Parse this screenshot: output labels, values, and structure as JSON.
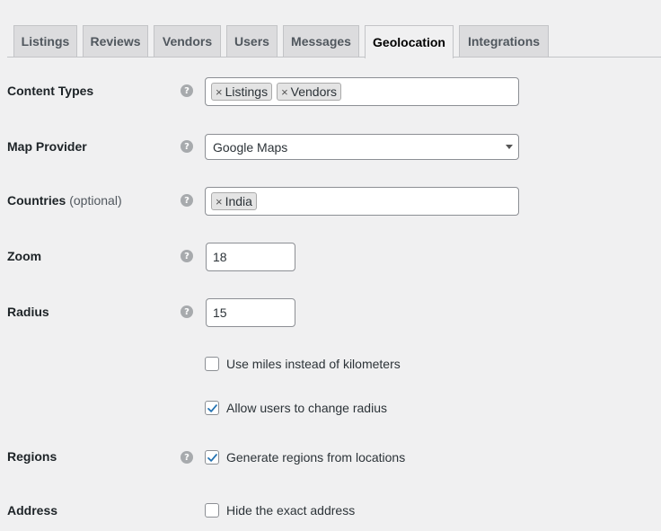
{
  "tabs": [
    {
      "label": "Listings",
      "active": false
    },
    {
      "label": "Reviews",
      "active": false
    },
    {
      "label": "Vendors",
      "active": false
    },
    {
      "label": "Users",
      "active": false
    },
    {
      "label": "Messages",
      "active": false
    },
    {
      "label": "Geolocation",
      "active": true
    },
    {
      "label": "Integrations",
      "active": false
    }
  ],
  "content_types": {
    "label": "Content Types",
    "tags": [
      "Listings",
      "Vendors"
    ]
  },
  "map_provider": {
    "label": "Map Provider",
    "value": "Google Maps"
  },
  "countries": {
    "label": "Countries",
    "optional": "(optional)",
    "tags": [
      "India"
    ]
  },
  "zoom": {
    "label": "Zoom",
    "value": "18"
  },
  "radius": {
    "label": "Radius",
    "value": "15"
  },
  "use_miles": {
    "label": "Use miles instead of kilometers",
    "checked": false
  },
  "allow_radius": {
    "label": "Allow users to change radius",
    "checked": true
  },
  "regions": {
    "label": "Regions",
    "checkbox_label": "Generate regions from locations",
    "checked": true
  },
  "address": {
    "label": "Address",
    "checkbox_label": "Hide the exact address",
    "checked": false
  },
  "icons": {
    "help": "help-icon",
    "remove": "x-icon",
    "caret": "chevron-down-icon",
    "check": "check-icon"
  },
  "colors": {
    "background": "#f0f0f1",
    "tab_inactive": "#dcdcde",
    "check": "#2271b1"
  }
}
